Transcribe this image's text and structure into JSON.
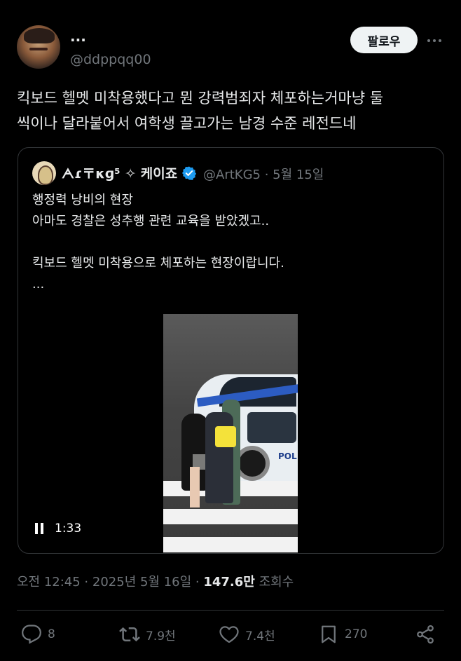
{
  "author": {
    "display_name": "...",
    "handle": "@ddppqq00"
  },
  "follow_button": {
    "label": "팔로우"
  },
  "more_button": {
    "label": "···"
  },
  "tweet": {
    "text": "킥보드 헬멧 미착용했다고 뭔 강력범죄자 체포하는거마냥 둘\n씩이나 달라붙어서 여학생 끌고가는 남경 수준 레전드네"
  },
  "quote": {
    "display_name": "ᗅɾ〒κɡ⁵ ✧ 케이죠",
    "handle": "@ArtKG5",
    "date": "5월 15일",
    "meta": "@ArtKG5 · 5월 15일",
    "text": "행정력 낭비의 현장\n아마도 경찰은 성추행 관련 교육을 받았겠고..\n\n킥보드 헬멧 미착용으로 체포하는 현장이랍니다.\n...",
    "video": {
      "duration": "1:33",
      "car_label": "POL"
    }
  },
  "timestamp": {
    "time": "오전 12:45 · 2025년 5월 16일 · ",
    "views": "147.6만",
    "views_label": " 조회수"
  },
  "actions": {
    "reply_count": "8",
    "retweet_count": "7.9천",
    "like_count": "7.4천",
    "bookmark_count": "270"
  },
  "colors": {
    "background": "#000000",
    "text": "#e7e9ea",
    "muted": "#71767b",
    "verified": "#1d9bf0",
    "border": "#333639"
  }
}
